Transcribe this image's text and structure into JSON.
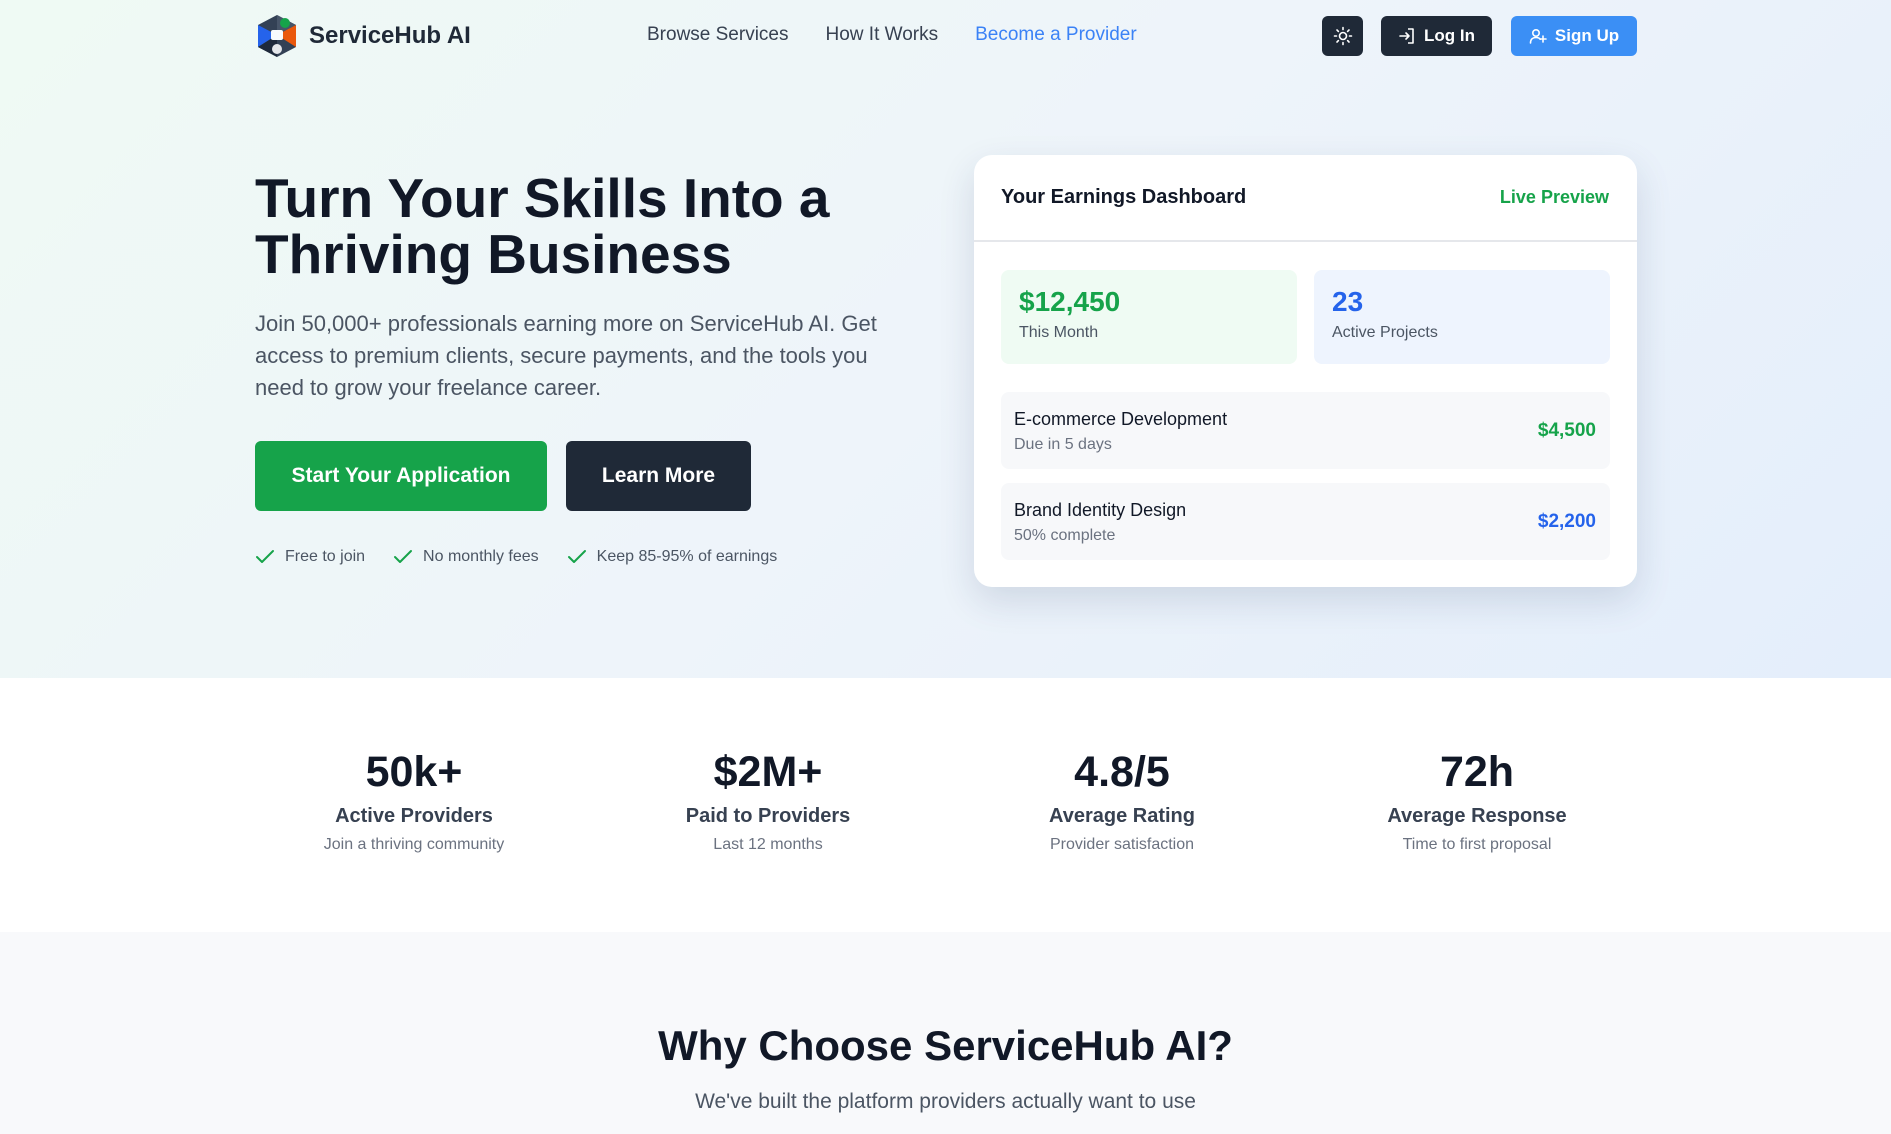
{
  "nav": {
    "brand": "ServiceHub AI",
    "links": [
      {
        "label": "Browse Services"
      },
      {
        "label": "How It Works"
      },
      {
        "label": "Become a Provider"
      }
    ],
    "login_label": "Log In",
    "signup_label": "Sign Up"
  },
  "hero": {
    "title": "Turn Your Skills Into a Thriving Business",
    "subtitle": "Join 50,000+ professionals earning more on ServiceHub AI. Get access to premium clients, secure payments, and the tools you need to grow your freelance career.",
    "primary_cta": "Start Your Application",
    "secondary_cta": "Learn More",
    "perks": [
      "Free to join",
      "No monthly fees",
      "Keep 85-95% of earnings"
    ]
  },
  "dashboard": {
    "title": "Your Earnings Dashboard",
    "badge": "Live Preview",
    "earnings_value": "$12,450",
    "earnings_label": "This Month",
    "projects_value": "23",
    "projects_label": "Active Projects",
    "projects": [
      {
        "name": "E-commerce Development",
        "meta": "Due in 5 days",
        "amount": "$4,500"
      },
      {
        "name": "Brand Identity Design",
        "meta": "50% complete",
        "amount": "$2,200"
      }
    ]
  },
  "stats": [
    {
      "value": "50k+",
      "label": "Active Providers",
      "desc": "Join a thriving community"
    },
    {
      "value": "$2M+",
      "label": "Paid to Providers",
      "desc": "Last 12 months"
    },
    {
      "value": "4.8/5",
      "label": "Average Rating",
      "desc": "Provider satisfaction"
    },
    {
      "value": "72h",
      "label": "Average Response",
      "desc": "Time to first proposal"
    }
  ],
  "why": {
    "title": "Why Choose ServiceHub AI?",
    "subtitle": "We've built the platform providers actually want to use"
  },
  "colors": {
    "primary_green": "#16a34a",
    "accent_blue": "#3b8ff5",
    "dark": "#1f2937"
  }
}
